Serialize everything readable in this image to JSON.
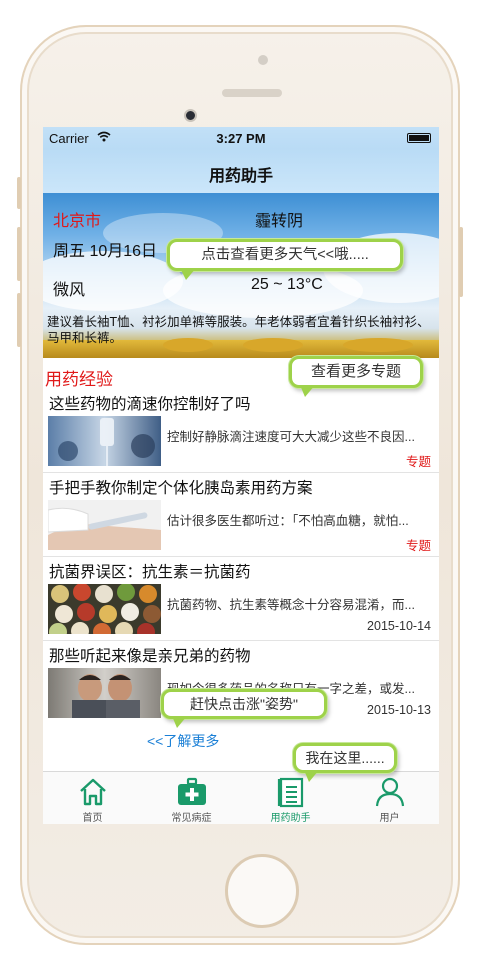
{
  "status_bar": {
    "carrier": "Carrier",
    "time": "3:27 PM"
  },
  "nav": {
    "title": "用药助手"
  },
  "weather": {
    "city": "北京市",
    "condition": "霾转阴",
    "date": "周五 10月16日",
    "wind": "微风",
    "temperature": "25 ~ 13°C",
    "tip": "建议着长袖T恤、衬衫加单裤等服装。年老体弱者宜着针织长袖衬衫、马甲和长裤。"
  },
  "bubbles": {
    "weather_more": "点击查看更多天气<<哦.....",
    "topics_more": "查看更多专题",
    "posture": "赶快点击涨\"姿势\"",
    "here": "我在这里......"
  },
  "section": {
    "title": "用药经验"
  },
  "articles": [
    {
      "title": "这些药物的滴速你控制好了吗",
      "desc": "控制好静脉滴注速度可大大减少这些不良因...",
      "meta": "专题",
      "meta_kind": "tag",
      "thumb": "iv-drip-image"
    },
    {
      "title": "手把手教你制定个体化胰岛素用药方案",
      "desc": "估计很多医生都听过：「不怕高血糖，就怕...",
      "meta": "专题",
      "meta_kind": "tag",
      "thumb": "insulin-pen-image"
    },
    {
      "title": "抗菌界误区：抗生素＝抗菌药",
      "desc": "抗菌药物、抗生素等概念十分容易混淆，而...",
      "meta": "2015-10-14",
      "meta_kind": "date",
      "thumb": "pills-bowls-image"
    },
    {
      "title": "那些听起来像是亲兄弟的药物",
      "desc": "现如今很多药品的名称只有一字之差，或发...",
      "meta": "2015-10-13",
      "meta_kind": "date",
      "thumb": "two-men-image"
    }
  ],
  "more_link": "<<了解更多",
  "tabs": [
    {
      "label": "首页",
      "icon": "home-icon",
      "active": false
    },
    {
      "label": "常见病症",
      "icon": "medical-kit-icon",
      "active": false
    },
    {
      "label": "用药助手",
      "icon": "prescription-doc-icon",
      "active": true
    },
    {
      "label": "用户",
      "icon": "user-icon",
      "active": false
    }
  ],
  "colors": {
    "accent_green": "#1a9a6a",
    "alert_red": "#e01818",
    "link_blue": "#1a7fd6",
    "bubble_border": "#9ed24a"
  }
}
